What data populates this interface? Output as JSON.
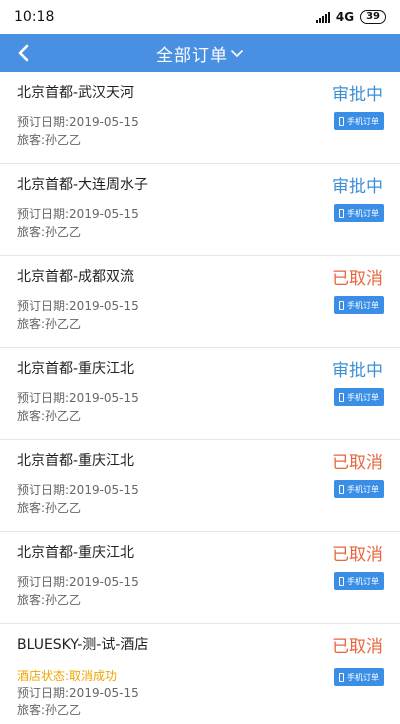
{
  "status_bar": {
    "time": "10:18",
    "network": "4G",
    "battery": "39"
  },
  "header": {
    "title": "全部订单"
  },
  "orders": [
    {
      "name": "北京首都-武汉天河",
      "status": "审批中",
      "status_type": "approving",
      "date_label": "预订日期:",
      "date": "2019-05-15",
      "traveler_label": "旅客:",
      "traveler": "孙乙乙",
      "badge": "手机订单"
    },
    {
      "name": "北京首都-大连周水子",
      "status": "审批中",
      "status_type": "approving",
      "date_label": "预订日期:",
      "date": "2019-05-15",
      "traveler_label": "旅客:",
      "traveler": "孙乙乙",
      "badge": "手机订单"
    },
    {
      "name": "北京首都-成都双流",
      "status": "已取消",
      "status_type": "cancelled",
      "date_label": "预订日期:",
      "date": "2019-05-15",
      "traveler_label": "旅客:",
      "traveler": "孙乙乙",
      "badge": "手机订单"
    },
    {
      "name": "北京首都-重庆江北",
      "status": "审批中",
      "status_type": "approving",
      "date_label": "预订日期:",
      "date": "2019-05-15",
      "traveler_label": "旅客:",
      "traveler": "孙乙乙",
      "badge": "手机订单"
    },
    {
      "name": "北京首都-重庆江北",
      "status": "已取消",
      "status_type": "cancelled",
      "date_label": "预订日期:",
      "date": "2019-05-15",
      "traveler_label": "旅客:",
      "traveler": "孙乙乙",
      "badge": "手机订单"
    },
    {
      "name": "北京首都-重庆江北",
      "status": "已取消",
      "status_type": "cancelled",
      "date_label": "预订日期:",
      "date": "2019-05-15",
      "traveler_label": "旅客:",
      "traveler": "孙乙乙",
      "badge": "手机订单"
    },
    {
      "name": "BLUESKY-测-试-酒店",
      "status": "已取消",
      "status_type": "cancelled",
      "hotel_status": "酒店状态:取消成功",
      "date_label": "预订日期:",
      "date": "2019-05-15",
      "traveler_label": "旅客:",
      "traveler": "孙乙乙",
      "badge": "手机订单"
    }
  ],
  "colors": {
    "nav": "#4a90e2",
    "approving": "#3d8fd8",
    "cancelled": "#e8663d",
    "hotel_status": "#f0a500",
    "badge": "#3a8ee6"
  },
  "icons": {
    "back": "chevron-left-icon",
    "title_dropdown": "chevron-down-icon",
    "badge": "phone-icon"
  }
}
